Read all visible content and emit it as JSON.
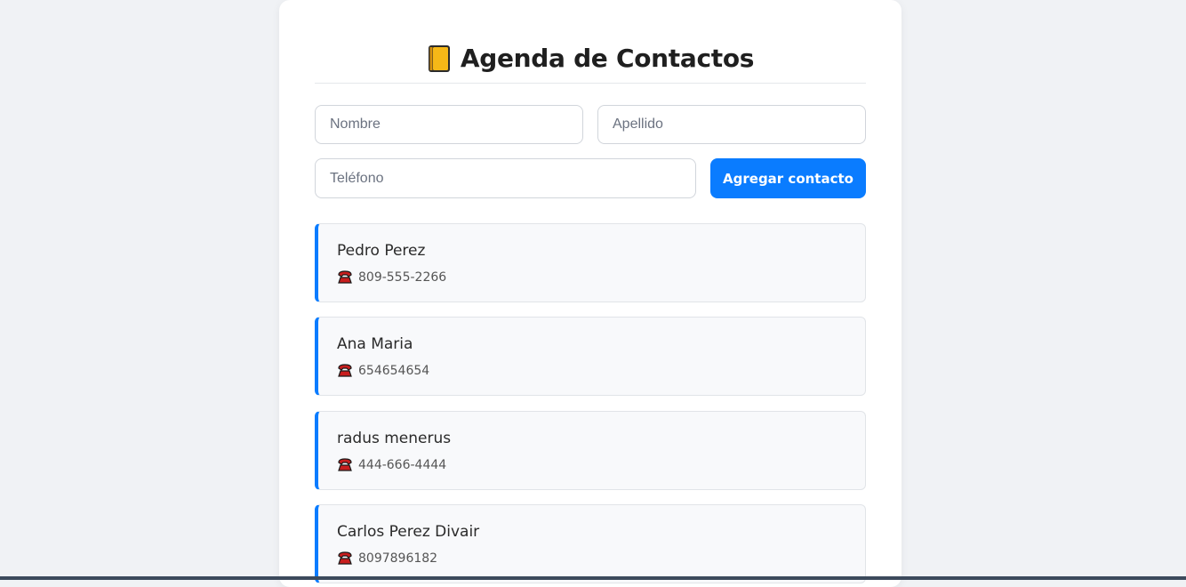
{
  "header": {
    "title": "Agenda de Contactos",
    "icon": "notebook-icon"
  },
  "form": {
    "nombre_placeholder": "Nombre",
    "apellido_placeholder": "Apellido",
    "telefono_placeholder": "Teléfono",
    "add_button_label": "Agregar contacto"
  },
  "contacts": [
    {
      "name": "Pedro Perez",
      "phone": "809-555-2266"
    },
    {
      "name": "Ana Maria",
      "phone": "654654654"
    },
    {
      "name": "radus menerus",
      "phone": "444-666-4444"
    },
    {
      "name": "Carlos Perez Divair",
      "phone": "8097896182"
    }
  ],
  "colors": {
    "accent": "#0a7cff",
    "background": "#f0f2f5",
    "card": "#ffffff"
  }
}
